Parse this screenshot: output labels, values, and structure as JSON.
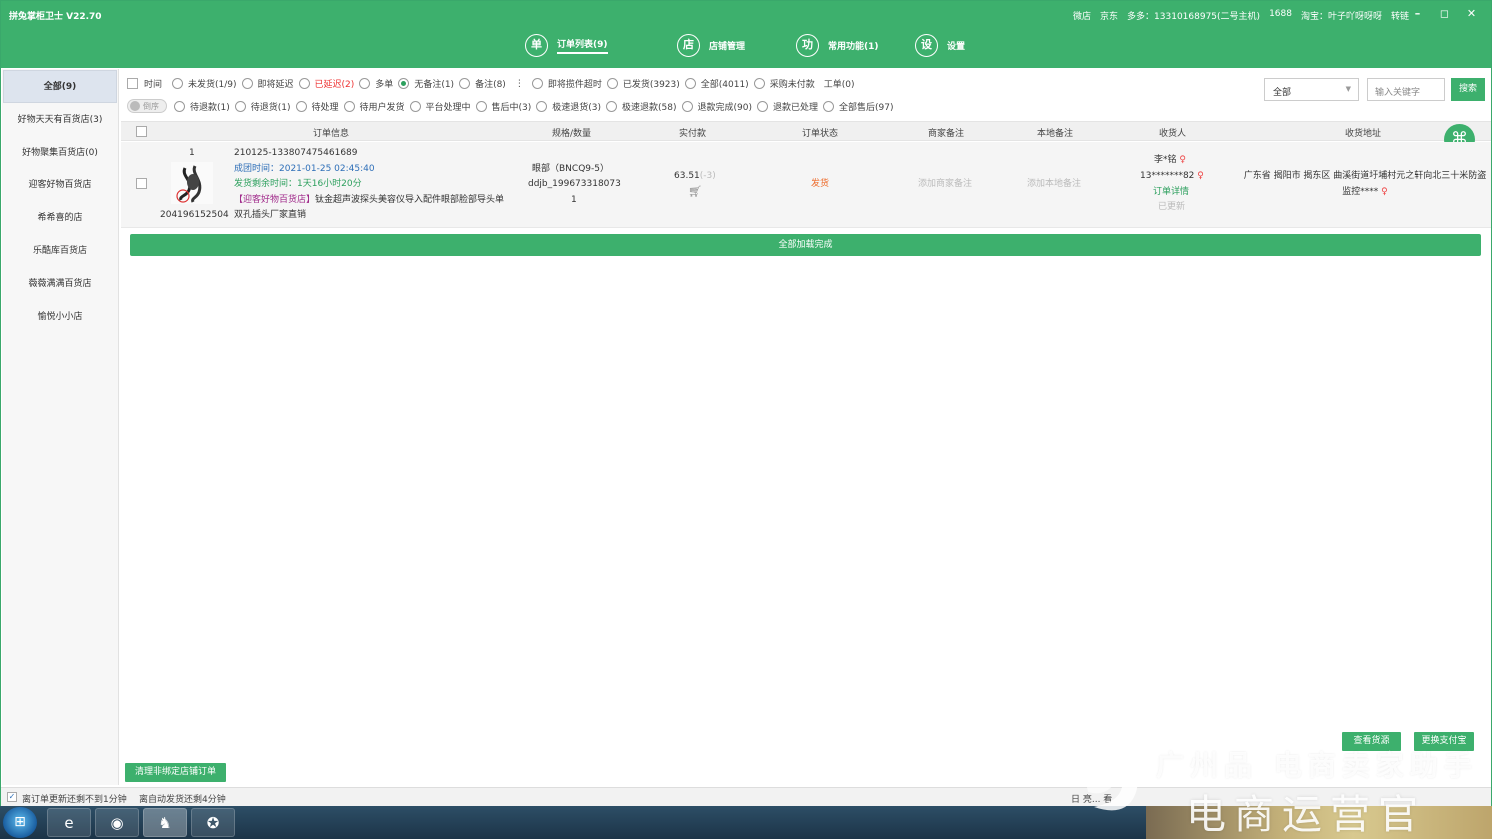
{
  "app": {
    "title": "拼兔掌柜卫士 V22.70"
  },
  "account_bar": [
    "微店",
    "京东",
    "多多：13310168975(二号主机)",
    "1688",
    "淘宝：叶子吖呀呀呀",
    "转链"
  ],
  "window_controls": {
    "minimize": "–",
    "maximize": "◻",
    "close": "✕"
  },
  "nav": [
    {
      "icon_char": "单",
      "label": "订单列表(9)",
      "active": true
    },
    {
      "icon_char": "店",
      "label": "店铺管理",
      "active": false
    },
    {
      "icon_char": "功",
      "label": "常用功能(1)",
      "active": false
    },
    {
      "icon_char": "设",
      "label": "设置",
      "active": false
    }
  ],
  "sidebar": {
    "items": [
      {
        "label": "全部(9)",
        "active": true
      },
      {
        "label": "好物天天有百货店(3)"
      },
      {
        "label": "好物聚集百货店(0)"
      },
      {
        "label": "迎客好物百货店"
      },
      {
        "label": "希希喜的店"
      },
      {
        "label": "乐酷库百货店"
      },
      {
        "label": "薇薇满满百货店"
      },
      {
        "label": "愉悦小小店"
      }
    ]
  },
  "filters": {
    "time_label": "时间",
    "sort_label": "倒序",
    "row1": [
      {
        "label": "未发货(1/9)"
      },
      {
        "label": "即将延迟"
      },
      {
        "label": "已延迟(2)",
        "style": "red"
      },
      {
        "label": "多单"
      },
      {
        "label": "无备注(1)",
        "checked": true
      },
      {
        "label": "备注(8)"
      },
      {
        "label": "即将揽件超时"
      },
      {
        "label": "已发货(3923)"
      },
      {
        "label": "全部(4011)"
      },
      {
        "label": "采购未付款"
      }
    ],
    "row1_more": "⋮",
    "row1_extra": "工单(0)",
    "row2": [
      {
        "label": "待退款(1)"
      },
      {
        "label": "待退货(1)"
      },
      {
        "label": "待处理"
      },
      {
        "label": "待用户发货"
      },
      {
        "label": "平台处理中"
      },
      {
        "label": "售后中(3)"
      },
      {
        "label": "极速退货(3)"
      },
      {
        "label": "极速退款(58)"
      },
      {
        "label": "退款完成(90)"
      },
      {
        "label": "退款已处理"
      },
      {
        "label": "全部售后(97)"
      }
    ],
    "select_value": "全部",
    "search_placeholder": "输入关键字",
    "search_button": "搜索"
  },
  "table": {
    "headers": [
      "订单信息",
      "规格/数量",
      "实付款",
      "订单状态",
      "商家备注",
      "本地备注",
      "收货人",
      "收货地址"
    ],
    "rows": [
      {
        "index": "1",
        "goods_id": "204196152504",
        "order_no": "210125-133807475461689",
        "group_time": "成团时间：2021-01-25 02:45:40",
        "remaining": "发货剩余时间：1天16小时20分",
        "shop_tag": "【迎客好物百货店】",
        "title": "钛金超声波探头美容仪导入配件眼部脸部导头单双孔插头厂家直销",
        "spec": "眼部（BNCQ9-5）",
        "sku": "ddjb_199673318073",
        "qty": "1",
        "paid": "63.51",
        "paid_extra": "(-3)",
        "status": "发货",
        "merchant_note": "添加商家备注",
        "local_note": "添加本地备注",
        "receiver_name": "李*铭",
        "receiver_phone": "13*******82",
        "order_detail": "订单详情",
        "updated": "已更新",
        "address": "广东省 揭阳市 揭东区 曲溪街道圩埔村元之轩向北三十米防盗监控****"
      }
    ]
  },
  "load_complete": "全部加载完成",
  "buttons": {
    "clear_unbound": "清理非绑定店铺订单",
    "view_source": "查看货源",
    "change_alipay": "更换支付宝"
  },
  "status_bar": {
    "update_text": "离订单更新还剩不到1分钟",
    "auto_ship_text": "离自动发货还剩4分钟",
    "right_text": "日 亮... 看"
  },
  "taskbar": {
    "start": "⊞",
    "apps": [
      "e",
      "◉",
      "♞",
      "✪"
    ]
  },
  "watermark": {
    "line1": "广州品 电商卖家助手",
    "line2": "电商运营官"
  }
}
